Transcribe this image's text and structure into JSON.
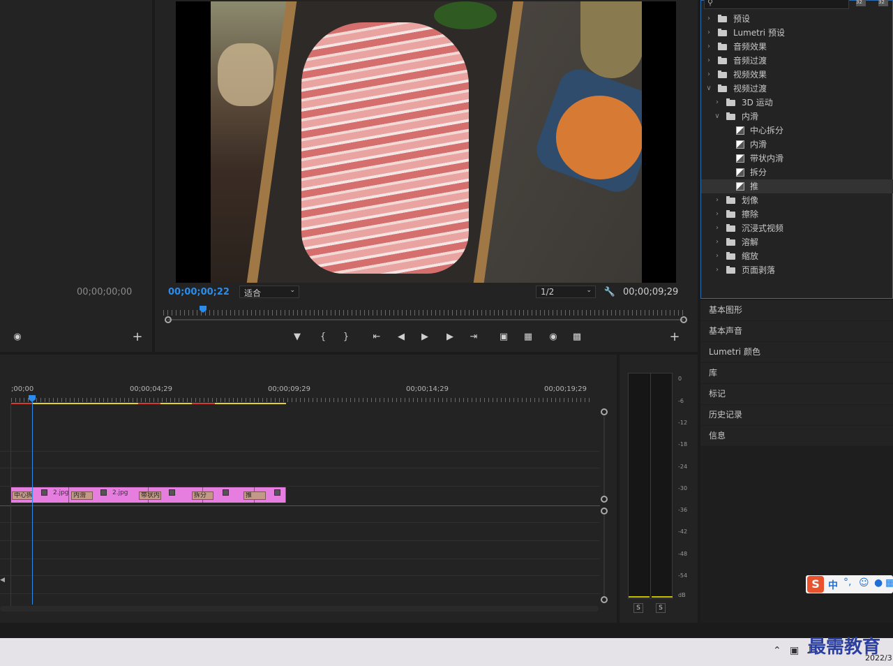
{
  "source_monitor": {
    "timecode": "00;00;00;00"
  },
  "program_monitor": {
    "timecode_current": "00;00;00;22",
    "fit_select": "适合",
    "resolution_select": "1/2",
    "timecode_duration": "00;00;09;29"
  },
  "effects_panel": {
    "items": [
      {
        "label": "预设",
        "level": 0,
        "type": "folder-preset",
        "expanded": false
      },
      {
        "label": "Lumetri 预设",
        "level": 0,
        "type": "folder-preset",
        "expanded": false
      },
      {
        "label": "音频效果",
        "level": 0,
        "type": "folder",
        "expanded": false
      },
      {
        "label": "音频过渡",
        "level": 0,
        "type": "folder",
        "expanded": false
      },
      {
        "label": "视频效果",
        "level": 0,
        "type": "folder",
        "expanded": false
      },
      {
        "label": "视频过渡",
        "level": 0,
        "type": "folder",
        "expanded": true
      },
      {
        "label": "3D 运动",
        "level": 1,
        "type": "folder",
        "expanded": false
      },
      {
        "label": "内滑",
        "level": 1,
        "type": "folder",
        "expanded": true
      },
      {
        "label": "中心拆分",
        "level": 2,
        "type": "effect"
      },
      {
        "label": "内滑",
        "level": 2,
        "type": "effect"
      },
      {
        "label": "带状内滑",
        "level": 2,
        "type": "effect"
      },
      {
        "label": "拆分",
        "level": 2,
        "type": "effect"
      },
      {
        "label": "推",
        "level": 2,
        "type": "effect",
        "selected": true
      },
      {
        "label": "划像",
        "level": 1,
        "type": "folder",
        "expanded": false
      },
      {
        "label": "擦除",
        "level": 1,
        "type": "folder",
        "expanded": false
      },
      {
        "label": "沉浸式视频",
        "level": 1,
        "type": "folder",
        "expanded": false
      },
      {
        "label": "溶解",
        "level": 1,
        "type": "folder",
        "expanded": false
      },
      {
        "label": "缩放",
        "level": 1,
        "type": "folder",
        "expanded": false
      },
      {
        "label": "页面剥落",
        "level": 1,
        "type": "folder",
        "expanded": false
      }
    ]
  },
  "right_panels": [
    "基本图形",
    "基本声音",
    "Lumetri 颜色",
    "库",
    "标记",
    "历史记录",
    "信息"
  ],
  "timeline": {
    "ruler_labels": [
      ";00;00",
      "00;00;04;29",
      "00;00;09;29",
      "00;00;14;29",
      "00;00;19;29"
    ],
    "clips": [
      {
        "name": "2.jpg"
      },
      {
        "name": "2.jpg"
      }
    ],
    "transitions": [
      "中心拆",
      "内滑",
      "带状内",
      "拆分",
      "推"
    ]
  },
  "audio_meter": {
    "db_labels": [
      "0",
      "-6",
      "-12",
      "-18",
      "-24",
      "-30",
      "-36",
      "-42",
      "-48",
      "-54",
      "dB"
    ],
    "solo_buttons": [
      "S",
      "S"
    ]
  },
  "ime": {
    "mode": "中"
  },
  "taskbar": {
    "date": "2022/3",
    "watermark": "最需教育"
  },
  "colors": {
    "accent_blue": "#2d8ceb",
    "clip_pink": "#e67ee0",
    "transition_tan": "#c39a87",
    "workarea_yellow": "#e3d32a",
    "render_red": "#d93a2e"
  }
}
